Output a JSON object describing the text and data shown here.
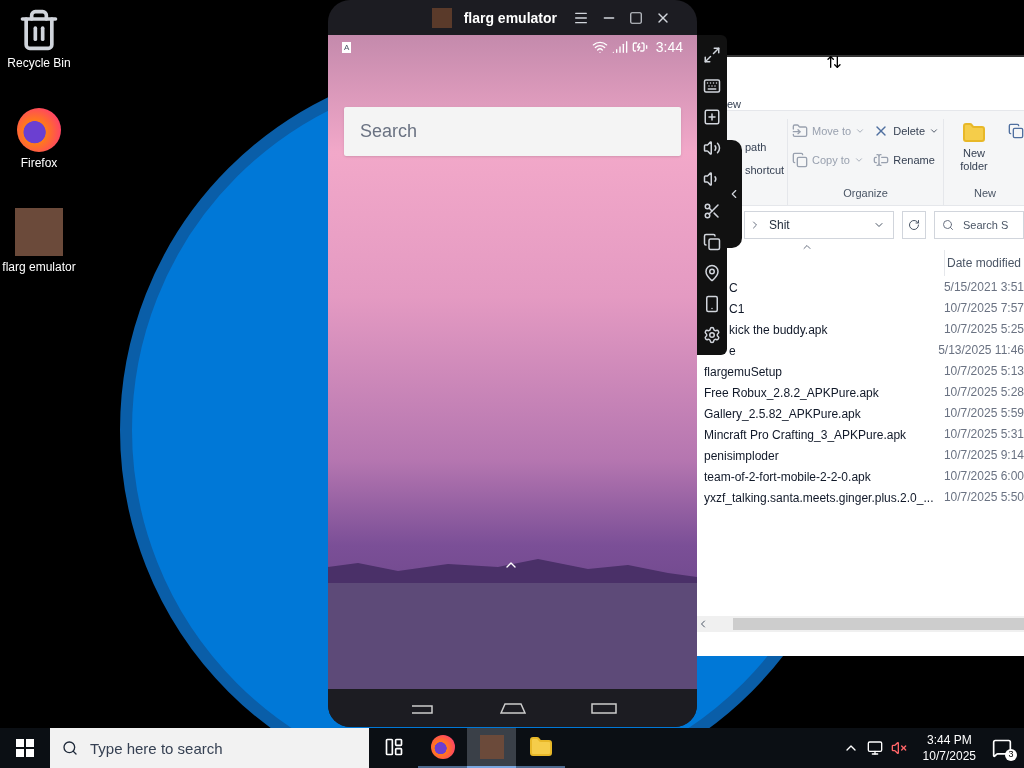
{
  "desktop_icons": [
    {
      "label": "Recycle Bin",
      "kind": "recycle"
    },
    {
      "label": "Firefox",
      "kind": "firefox"
    },
    {
      "label": "flarg emulator",
      "kind": "app"
    }
  ],
  "explorer": {
    "ribbon_tab": "ew",
    "clipboard_items": [
      "path",
      "shortcut"
    ],
    "organize": {
      "title": "Organize",
      "items": [
        {
          "label": "Move to",
          "kind": "move",
          "dropdown": true
        },
        {
          "label": "Copy to",
          "kind": "copy",
          "dropdown": true
        },
        {
          "label": "Delete",
          "kind": "delete",
          "dropdown": true
        },
        {
          "label": "Rename",
          "kind": "rename",
          "dropdown": false
        }
      ]
    },
    "new_group": {
      "title": "New",
      "button": "New folder"
    },
    "address": "Shit",
    "search_placeholder": "Search S",
    "column_2": "Date modified",
    "files": [
      {
        "name": "C",
        "date": "5/15/2021 3:51"
      },
      {
        "name": "C1",
        "date": "10/7/2025 7:57"
      },
      {
        "name": "kick the buddy.apk",
        "date": "10/7/2025 5:25"
      },
      {
        "name": "e",
        "date": "5/13/2025 11:46"
      },
      {
        "name": "flargemuSetup",
        "date": "10/7/2025 5:13"
      },
      {
        "name": "Free Robux_2.8.2_APKPure.apk",
        "date": "10/7/2025 5:28"
      },
      {
        "name": "Gallery_2.5.82_APKPure.apk",
        "date": "10/7/2025 5:59"
      },
      {
        "name": "Mincraft Pro Crafting_3_APKPure.apk",
        "date": "10/7/2025 5:31"
      },
      {
        "name": "penisimploder",
        "date": "10/7/2025 9:14"
      },
      {
        "name": "team-of-2-fort-mobile-2-2-0.apk",
        "date": "10/7/2025 6:00"
      },
      {
        "name": "yxzf_talking.santa.meets.ginger.plus.2.0_...",
        "date": "10/7/2025 5:50"
      }
    ]
  },
  "emulator": {
    "title": "flarg emulator",
    "status_badge": "A",
    "time": "3:44",
    "search_placeholder": "Search"
  },
  "taskbar": {
    "search_placeholder": "Type here to search",
    "apps": [
      {
        "kind": "taskview",
        "selected": false
      },
      {
        "kind": "firefox",
        "selected": false
      },
      {
        "kind": "emulator",
        "selected": true
      },
      {
        "kind": "explorer",
        "selected": false
      }
    ],
    "muted": true,
    "time": "3:44 PM",
    "date": "10/7/2025",
    "notifications": "3"
  }
}
